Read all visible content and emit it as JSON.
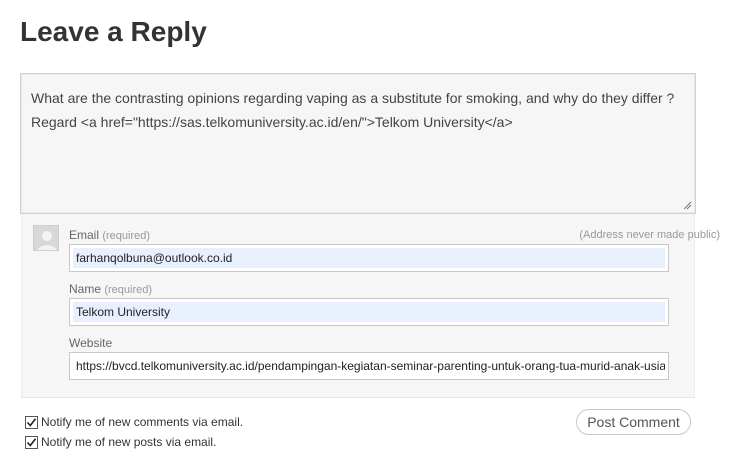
{
  "heading": "Leave a Reply",
  "comment": {
    "lines": [
      "What are the contrasting opinions regarding vaping as a substitute for smoking, and why do they differ ?",
      "Regard <a href=\"https://sas.telkomuniversity.ac.id/en/\">Telkom University</a>"
    ]
  },
  "identity": {
    "address_hint": "(Address never made public)",
    "email": {
      "label": "Email",
      "required": "(required)",
      "value": "farhanqolbuna@outlook.co.id"
    },
    "name": {
      "label": "Name",
      "required": "(required)",
      "value": "Telkom University"
    },
    "website": {
      "label": "Website",
      "value": "https://bvcd.telkomuniversity.ac.id/pendampingan-kegiatan-seminar-parenting-untuk-orang-tua-murid-anak-usia"
    }
  },
  "notify": {
    "comments": {
      "label": "Notify me of new comments via email.",
      "checked": true
    },
    "posts": {
      "label": "Notify me of new posts via email.",
      "checked": true
    }
  },
  "submit_label": "Post Comment",
  "icons": {
    "avatar": "default-avatar-icon",
    "check": "checkmark-icon",
    "resize": "resize-handle-icon"
  }
}
